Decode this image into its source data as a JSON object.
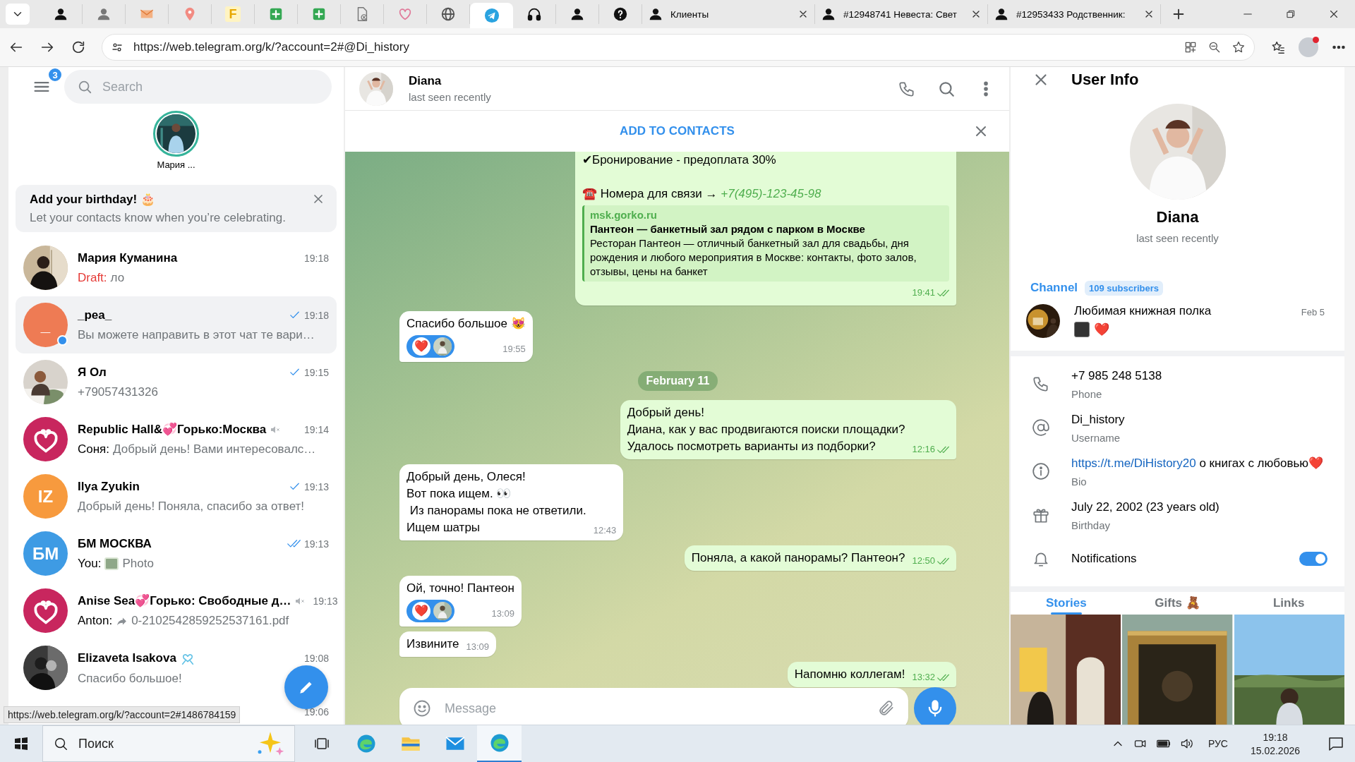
{
  "browser": {
    "tabs": [
      {
        "kind": "person",
        "selected": false
      },
      {
        "kind": "person-grey",
        "selected": false
      },
      {
        "kind": "envelope",
        "selected": false
      },
      {
        "kind": "pin",
        "selected": false
      },
      {
        "kind": "glyph",
        "glyph": "F",
        "selected": false
      },
      {
        "kind": "sheet",
        "selected": false
      },
      {
        "kind": "sheet",
        "selected": false
      },
      {
        "kind": "file",
        "selected": false
      },
      {
        "kind": "heart",
        "selected": false
      },
      {
        "kind": "globe",
        "selected": false
      },
      {
        "kind": "telegram",
        "selected": true
      },
      {
        "kind": "headphones",
        "selected": false
      },
      {
        "kind": "person",
        "selected": false
      },
      {
        "kind": "question",
        "selected": false
      },
      {
        "kind": "person",
        "title": "Клиенты",
        "selected": false
      },
      {
        "kind": "person",
        "title": "#12948741 Невеста: Свет",
        "selected": false
      },
      {
        "kind": "person",
        "title": "#12953433 Родственник:",
        "selected": false
      }
    ],
    "url": "https://web.telegram.org/k/?account=2#@Di_history"
  },
  "sidebar": {
    "menu_badge": "3",
    "search": {
      "placeholder": "Search"
    },
    "stories": [
      {
        "name": "Мария ..."
      }
    ],
    "birthday_card": {
      "title": "Add your birthday! 🎂",
      "text": "Let your contacts know when you’re celebrating."
    },
    "chats": [
      {
        "name": "Мария Куманина",
        "time": "19:18",
        "sent": false,
        "read": false,
        "prefix": "Draft:",
        "draft": true,
        "photo": false,
        "forwarded": false,
        "preview": "ло",
        "muted": false,
        "online": false,
        "emoji_status": false,
        "selected": false
      },
      {
        "name": "_pea_",
        "time": "19:18",
        "sent": true,
        "read": false,
        "photo": false,
        "forwarded": false,
        "preview": "Вы можете направить в этот чат те вари…",
        "avatar": {
          "kind": "initials",
          "initials": "_",
          "color": "#ee7b54"
        },
        "muted": false,
        "online": true,
        "emoji_status": false,
        "selected": true
      },
      {
        "name": "Я Ол",
        "time": "19:15",
        "sent": true,
        "read": false,
        "photo": false,
        "forwarded": false,
        "preview": "+79057431326",
        "muted": false,
        "online": false,
        "emoji_status": false,
        "selected": false
      },
      {
        "name": "Republic Hall&💞Горько:Москва",
        "time": "19:14",
        "sent": false,
        "read": false,
        "prefix": "Соня:",
        "draft": false,
        "photo": false,
        "forwarded": false,
        "preview": "Добрый день! Вами интересовалс…",
        "avatar": {
          "kind": "logo",
          "color": "#c8265e"
        },
        "muted": true,
        "online": false,
        "emoji_status": false,
        "selected": false
      },
      {
        "name": "Ilya Zyukin",
        "time": "19:13",
        "sent": true,
        "read": false,
        "photo": false,
        "forwarded": false,
        "preview": "Добрый день! Поняла, спасибо за ответ!",
        "avatar": {
          "kind": "initials",
          "initials": "IZ",
          "color": "#f79a3e"
        },
        "muted": false,
        "online": false,
        "emoji_status": false,
        "selected": false
      },
      {
        "name": "БМ МОСКВА",
        "time": "19:13",
        "sent": true,
        "read": true,
        "prefix": "You:",
        "draft": false,
        "photo": true,
        "forwarded": false,
        "preview": "Photo",
        "avatar": {
          "kind": "initials",
          "initials": "БМ",
          "color": "#3e9be4"
        },
        "muted": false,
        "online": false,
        "emoji_status": false,
        "selected": false
      },
      {
        "name": "Anise Sea💞Горько: Свободные д…",
        "time": "19:13",
        "sent": false,
        "read": false,
        "prefix": "Anton:",
        "draft": false,
        "photo": false,
        "forwarded": true,
        "preview": "0-2102542859252537161.pdf",
        "avatar": {
          "kind": "logo",
          "color": "#c8265e"
        },
        "muted": true,
        "online": false,
        "emoji_status": false,
        "selected": false
      },
      {
        "name": "Elizaveta Isakova",
        "time": "19:08",
        "sent": false,
        "read": false,
        "photo": false,
        "forwarded": false,
        "preview": "Спасибо большое!",
        "muted": false,
        "online": false,
        "emoji_status": true,
        "selected": false
      },
      {
        "time": "19:06"
      }
    ]
  },
  "chat": {
    "name": "Diana",
    "status": "last seen recently",
    "add_contacts": "ADD TO CONTACTS",
    "composer": {
      "placeholder": "Message"
    },
    "messages": [
      {
        "kind": "out",
        "text": "✔Бронирование -  предоплата 30%",
        "contact_label": "☎️ Номера для связи →",
        "phone": "+7(495)-123-45-98",
        "preview": {
          "site": "msk.gorko.ru",
          "title": "Пантеон — банкетный зал рядом с парком в Москве",
          "description": "Ресторан Пантеон — отличный банкетный зал для свадьбы, дня рождения и любого мероприятия в Москве: контакты, фото залов, отзывы, цены на банкет"
        },
        "time": "19:41",
        "read": true
      },
      {
        "kind": "in",
        "text": "Спасибо большое 😻",
        "reactions": [
          {
            "emoji": "❤️"
          }
        ],
        "time": "19:55"
      },
      {
        "kind": "date",
        "text": "February 11"
      },
      {
        "kind": "out",
        "text": "Добрый день!\nДиана, как у вас продвигаются поиски площадки?\nУдалось посмотреть варианты из подборки?",
        "time": "12:16",
        "read": true
      },
      {
        "kind": "in",
        "text": "Добрый день, Олеся!\nВот пока ищем. 👀\n Из панорамы пока не ответили.\nИщем шатры",
        "time": "12:43"
      },
      {
        "kind": "out",
        "text": "Поняла, а какой панорамы? Пантеон?",
        "time": "12:50",
        "read": true
      },
      {
        "kind": "in",
        "text": "Ой, точно! Пантеон",
        "reactions": [
          {
            "emoji": "❤️"
          }
        ],
        "time": "13:09"
      },
      {
        "kind": "in",
        "text": "Извините",
        "time": "13:09"
      },
      {
        "kind": "out",
        "text": "Напомню коллегам!",
        "time": "13:32",
        "read": true
      }
    ]
  },
  "user_info": {
    "title": "User Info",
    "name": "Diana",
    "status": "last seen recently",
    "channel": {
      "label": "Channel",
      "subscribers": "109 subscribers",
      "title": "Любимая книжная полка",
      "preview": "❤️",
      "date": "Feb 5"
    },
    "rows": [
      {
        "kind": "phone",
        "value": "+7 985 248 5138",
        "caption": "Phone"
      },
      {
        "kind": "username",
        "value": "Di_history",
        "caption": "Username"
      },
      {
        "kind": "bio",
        "link": "https://t.me/DiHistory20",
        "value": " о книгах с любовью❤️",
        "caption": "Bio"
      },
      {
        "kind": "birthday",
        "value": "July 22, 2002 (23 years old)",
        "caption": "Birthday"
      },
      {
        "kind": "notifications",
        "value": "Notifications",
        "on": true
      }
    ],
    "tabs": [
      {
        "label": "Stories",
        "selected": true
      },
      {
        "label": "Gifts 🧸",
        "selected": false
      },
      {
        "label": "Links",
        "selected": false
      }
    ]
  },
  "status_tooltip": "https://web.telegram.org/k/?account=2#1486784159",
  "taskbar": {
    "search": {
      "placeholder": "Поиск"
    },
    "apps": [
      {
        "kind": "task-view",
        "selected": false
      },
      {
        "kind": "edge",
        "selected": false
      },
      {
        "kind": "folder",
        "selected": false
      },
      {
        "kind": "mail",
        "selected": false
      },
      {
        "kind": "edge",
        "selected": true
      }
    ],
    "language": "РУС",
    "time": "19:18",
    "date": "15.02.2026"
  }
}
